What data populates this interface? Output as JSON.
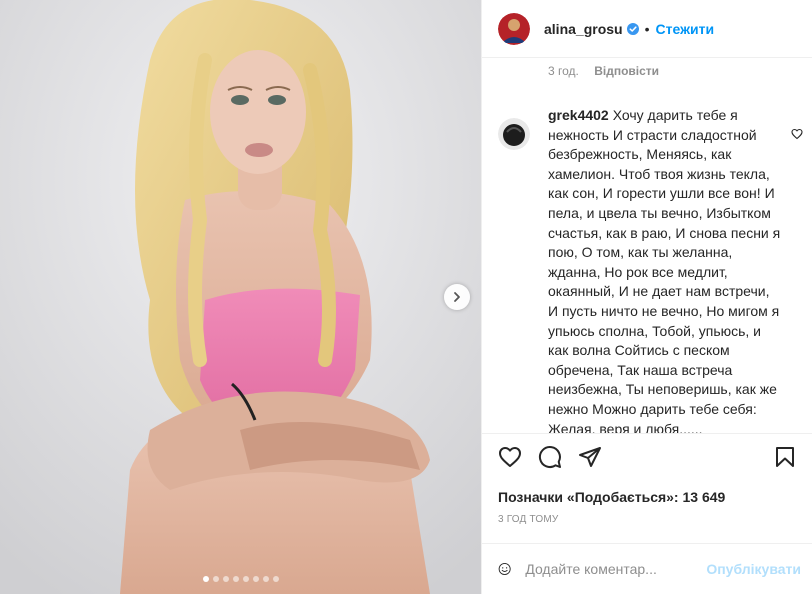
{
  "post": {
    "author": "alina_grosu",
    "follow_label": "Стежити",
    "separator": "•",
    "meta_time": "3 год.",
    "reply_label": "Відповісти",
    "media_dots": 8,
    "active_dot": 0
  },
  "comment": {
    "user": "grek4402",
    "text": "Хочу дарить тебе я нежность И страсти сладостной безбрежность, Меняясь, как хамелион. Чтоб твоя жизнь текла, как сон, И горести ушли все вон! И пела, и цвела ты вечно, Избытком счастья, как в раю, И снова песни я пою, О том, как ты желанна, жданна, Но рок все медлит, окаянный, И не дает нам встречи, И пусть ничто не вечно, Но мигом я упьюсь сполна, Тобой, упьюсь, и как волна Сойтись с песком обречена, Так наша встреча неизбежна, Ты неповеришь, как же нежно Можно дарить тебе себя: Желая, веря и любя......"
  },
  "likes_text": "Позначки «Подобається»: 13 649",
  "timestamp": "3 ГОД ТОМУ",
  "composer": {
    "placeholder": "Додайте коментар...",
    "publish_label": "Опублікувати"
  },
  "icons": {
    "next": "chevron-right-icon",
    "verified": "verified-badge-icon",
    "like": "heart-icon",
    "comment": "comment-icon",
    "share": "share-icon",
    "save": "bookmark-icon",
    "emoji": "emoji-icon"
  },
  "colors": {
    "accent": "#0095f6",
    "publish_disabled": "#b2dffc",
    "muted": "#8e8e8e"
  }
}
